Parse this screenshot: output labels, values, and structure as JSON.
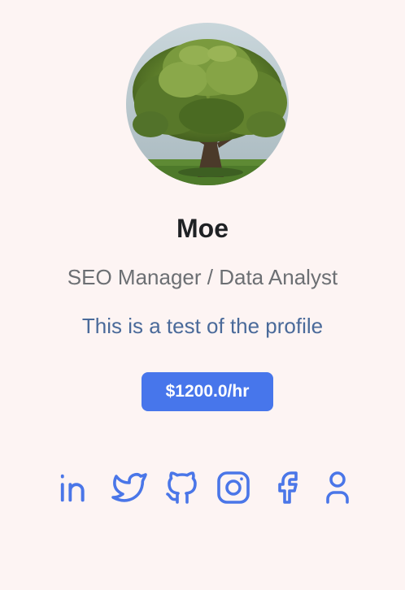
{
  "profile": {
    "name": "Moe",
    "title": "SEO Manager / Data Analyst",
    "bio": "This is a test of the profile",
    "rate": "$1200.0/hr",
    "avatar_description": "oak-tree-photo"
  },
  "colors": {
    "background": "#fdf4f3",
    "accent": "#4776eb",
    "icon": "#4a76e8",
    "name_text": "#1f2124",
    "title_text": "#6c6f73",
    "bio_text": "#4a6a9a"
  },
  "social_links": [
    {
      "icon": "linkedin-icon"
    },
    {
      "icon": "twitter-icon"
    },
    {
      "icon": "github-icon"
    },
    {
      "icon": "instagram-icon"
    },
    {
      "icon": "facebook-icon"
    },
    {
      "icon": "user-icon"
    }
  ]
}
